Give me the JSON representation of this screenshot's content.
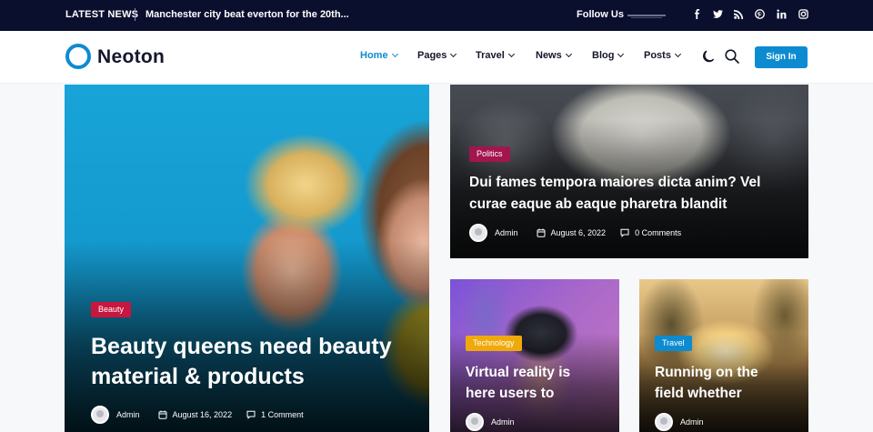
{
  "topbar": {
    "latest_label": "LATEST NEWS",
    "ticker_text": "Manchester city beat everton for the 20th...",
    "follow_label": "Follow Us",
    "social": [
      {
        "icon": "facebook-icon",
        "glyph": "f"
      },
      {
        "icon": "twitter-icon",
        "glyph": "t"
      },
      {
        "icon": "rss-icon",
        "glyph": "rss"
      },
      {
        "icon": "pinterest-icon",
        "glyph": "p"
      },
      {
        "icon": "linkedin-icon",
        "glyph": "in"
      },
      {
        "icon": "instagram-icon",
        "glyph": "ig"
      }
    ]
  },
  "header": {
    "logo_text": "Neoton",
    "nav": [
      {
        "label": "Home",
        "active": true
      },
      {
        "label": "Pages",
        "active": false
      },
      {
        "label": "Travel",
        "active": false
      },
      {
        "label": "News",
        "active": false
      },
      {
        "label": "Blog",
        "active": false
      },
      {
        "label": "Posts",
        "active": false
      }
    ],
    "signin_label": "Sign In"
  },
  "colors": {
    "accent": "#0d8bd1",
    "topbar_bg": "#0b0f2e",
    "badge_beauty": "#c8163f",
    "badge_politics": "#a3154f",
    "badge_technology": "#f0a90b",
    "badge_travel": "#0d8bd1"
  },
  "posts": {
    "hero": {
      "category": "Beauty",
      "title_line1": "Beauty queens need beauty",
      "title_line2": "material & products",
      "author": "Admin",
      "date": "August 16, 2022",
      "comments": "1 Comment"
    },
    "politics": {
      "category": "Politics",
      "title_line1": "Dui fames tempora maiores dicta anim? Vel",
      "title_line2": "curae eaque ab eaque pharetra blandit",
      "author": "Admin",
      "date": "August 6, 2022",
      "comments": "0 Comments"
    },
    "technology": {
      "category": "Technology",
      "title_line1": "Virtual reality is",
      "title_line2": "here users to",
      "author": "Admin"
    },
    "travel": {
      "category": "Travel",
      "title_line1": "Running on the",
      "title_line2": "field whether",
      "author": "Admin"
    }
  }
}
